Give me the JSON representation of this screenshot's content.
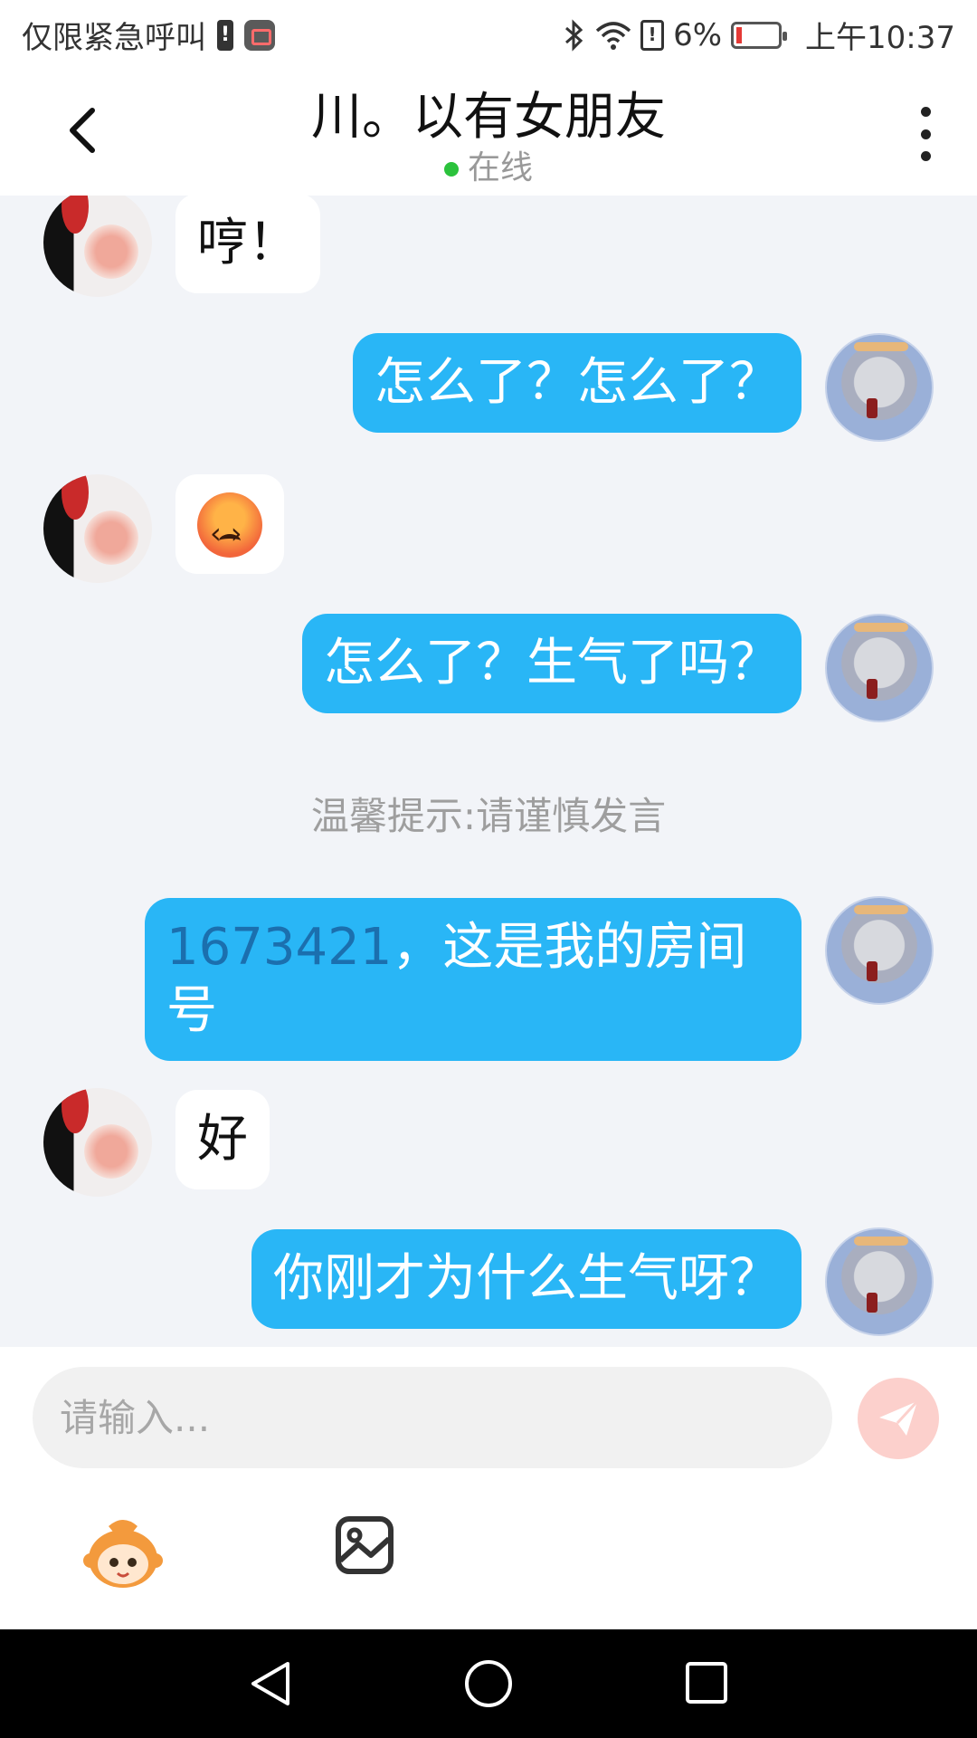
{
  "status_bar": {
    "carrier_text": "仅限紧急呼叫",
    "alert_badge": "!",
    "sd_badge": "!",
    "battery_percent": "6%",
    "time": "上午10:37",
    "icons": [
      "bluetooth-icon",
      "wifi-icon",
      "sd-alert-icon",
      "battery-low-icon",
      "screen-record-icon"
    ]
  },
  "header": {
    "title": "川。以有女朋友",
    "status": "在线",
    "status_color": "#2bc23c"
  },
  "messages": [
    {
      "sender": "other",
      "text": "哼！"
    },
    {
      "sender": "me",
      "text": "怎么了？怎么了？"
    },
    {
      "sender": "other",
      "emoji": "angry-face-emoji"
    },
    {
      "sender": "me",
      "text": "怎么了？生气了吗？"
    },
    {
      "system": "温馨提示:请谨慎发言"
    },
    {
      "sender": "me",
      "number": "1673421",
      "text_rest": "，这是我的房间号"
    },
    {
      "sender": "other",
      "text": "好"
    },
    {
      "sender": "me",
      "text": "你刚才为什么生气呀？"
    }
  ],
  "composer": {
    "placeholder": "请输入...",
    "value": "",
    "send_icon": "paper-plane-icon",
    "tools": [
      "sticker-icon",
      "image-icon"
    ]
  },
  "nav_bar": {
    "icons": [
      "nav-back-icon",
      "nav-home-icon",
      "nav-recent-icon"
    ]
  },
  "colors": {
    "accent_bubble": "#29b6f6",
    "chat_background": "#f2f4f8",
    "send_button": "#fcd0cc"
  }
}
